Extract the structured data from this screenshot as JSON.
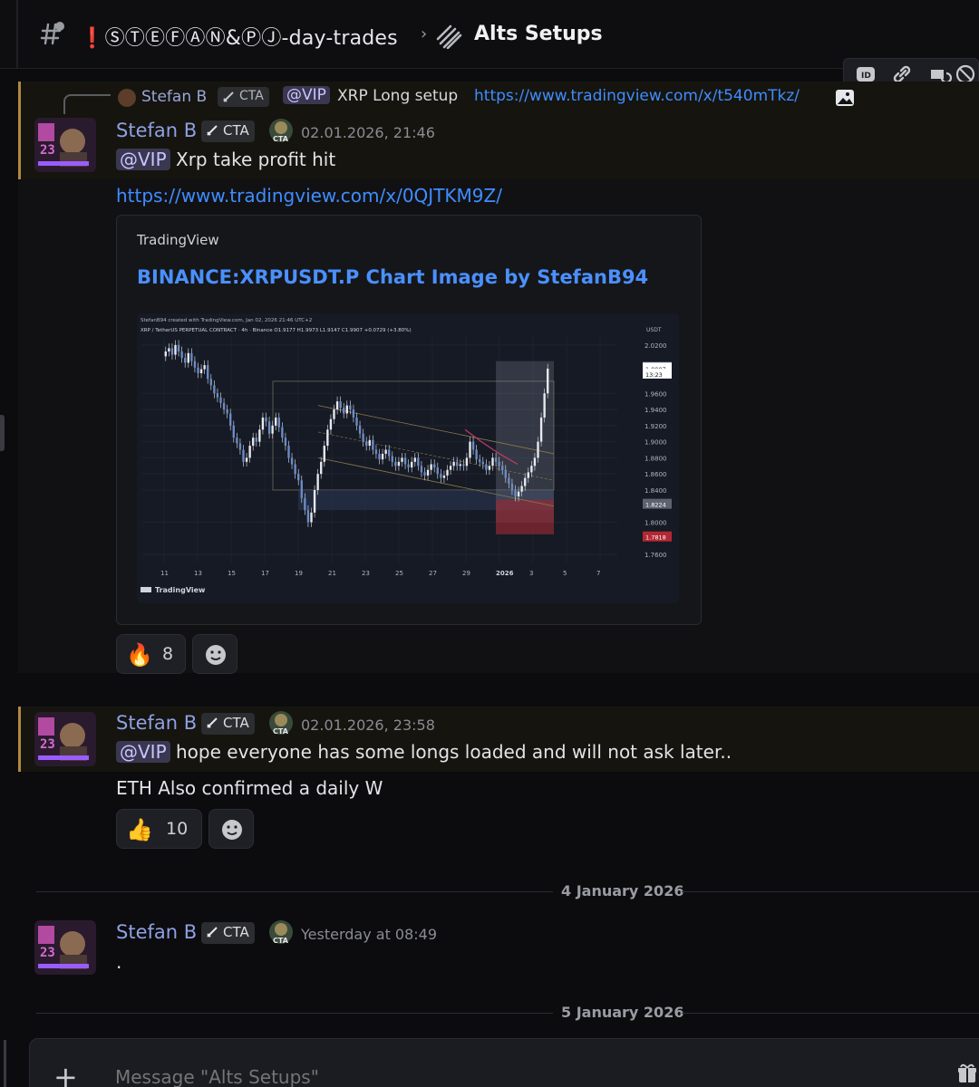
{
  "header": {
    "channel_name": "❗ⓈⓉⒺⒻⒶⓃ&ⓅⒿ-day-trades",
    "thread_name": "Alts Setups"
  },
  "reply": {
    "author": "Stefan B",
    "tag": "CTA",
    "mention": "@VIP",
    "text": "XRP Long setup",
    "link": "https://www.tradingview.com/x/t540mTkz/"
  },
  "messages": [
    {
      "author": "Stefan B",
      "tag": "CTA",
      "badge_text": "CTA",
      "timestamp": "02.01.2026, 21:46",
      "mention": "@VIP",
      "text": "Xrp take profit hit",
      "link": "https://www.tradingview.com/x/0QJTKM9Z/",
      "embed": {
        "provider": "TradingView",
        "title": "BINANCE:XRPUSDT.P Chart Image by StefanB94"
      },
      "reactions": [
        {
          "emoji": "🔥",
          "count": "8"
        }
      ]
    },
    {
      "author": "Stefan B",
      "tag": "CTA",
      "badge_text": "CTA",
      "timestamp": "02.01.2026, 23:58",
      "mention": "@VIP",
      "text": "hope everyone has some longs loaded and will not ask later..",
      "text2": "ETH Also confirmed a daily W",
      "reactions": [
        {
          "emoji": "👍",
          "count": "10"
        }
      ]
    },
    {
      "author": "Stefan B",
      "tag": "CTA",
      "badge_text": "CTA",
      "timestamp": "Yesterday at 08:49",
      "text": "."
    }
  ],
  "dividers": [
    "4 January 2026",
    "5 January 2026"
  ],
  "composer": {
    "placeholder": "Message \"Alts Setups\""
  },
  "chart_data": {
    "type": "candlestick",
    "watermark": "StefanB94 created with TradingView.com, Jan 02, 2026 21:46 UTC+2",
    "symbol_line": "XRP / TetherUS PERPETUAL CONTRACT · 4h · Binance  O1.9177 H1.9973 L1.9147 C1.9907 +0.0729 (+3.80%)",
    "currency": "USDT",
    "y_ticks": [
      "2.0200",
      "1.9600",
      "1.9400",
      "1.9200",
      "1.9000",
      "1.8800",
      "1.8600",
      "1.8400",
      "1.8000",
      "1.7600"
    ],
    "y_range": [
      1.75,
      2.03
    ],
    "price_tags": [
      {
        "label": "1.9920",
        "value": 1.992,
        "color": "#d1d4dc"
      },
      {
        "label": "1.9907",
        "value": 1.9907,
        "color": "#ffffff"
      },
      {
        "label": "13:23",
        "value": 1.984,
        "color": "#ffffff"
      },
      {
        "label": "1.8224",
        "value": 1.8224,
        "color": "#5d6270"
      },
      {
        "label": "1.7818",
        "value": 1.7818,
        "color": "#b22833"
      }
    ],
    "x_ticks": [
      "11",
      "13",
      "15",
      "17",
      "19",
      "21",
      "23",
      "25",
      "27",
      "29",
      "2026",
      "3",
      "5",
      "7"
    ],
    "footer": "TradingView",
    "closes": [
      2.012,
      2.016,
      2.008,
      2.02,
      2.012,
      2.004,
      1.998,
      2.01,
      2.0,
      1.992,
      1.985,
      1.99,
      1.995,
      1.978,
      1.97,
      1.96,
      1.955,
      1.948,
      1.94,
      1.935,
      1.92,
      1.905,
      1.898,
      1.89,
      1.875,
      1.88,
      1.895,
      1.905,
      1.9,
      1.915,
      1.93,
      1.925,
      1.91,
      1.92,
      1.93,
      1.918,
      1.905,
      1.895,
      1.88,
      1.872,
      1.86,
      1.852,
      1.83,
      1.815,
      1.8,
      1.812,
      1.84,
      1.86,
      1.875,
      1.895,
      1.915,
      1.928,
      1.94,
      1.95,
      1.942,
      1.935,
      1.945,
      1.94,
      1.93,
      1.92,
      1.91,
      1.9,
      1.895,
      1.902,
      1.89,
      1.885,
      1.878,
      1.885,
      1.89,
      1.882,
      1.875,
      1.87,
      1.875,
      1.88,
      1.872,
      1.868,
      1.875,
      1.88,
      1.87,
      1.862,
      1.858,
      1.865,
      1.872,
      1.868,
      1.86,
      1.855,
      1.858,
      1.865,
      1.87,
      1.875,
      1.87,
      1.872,
      1.87,
      1.88,
      1.9,
      1.89,
      1.878,
      1.875,
      1.872,
      1.865,
      1.87,
      1.88,
      1.875,
      1.87,
      1.865,
      1.855,
      1.848,
      1.84,
      1.832,
      1.838,
      1.845,
      1.855,
      1.862,
      1.87,
      1.88,
      1.9,
      1.93,
      1.96,
      1.9907
    ]
  }
}
